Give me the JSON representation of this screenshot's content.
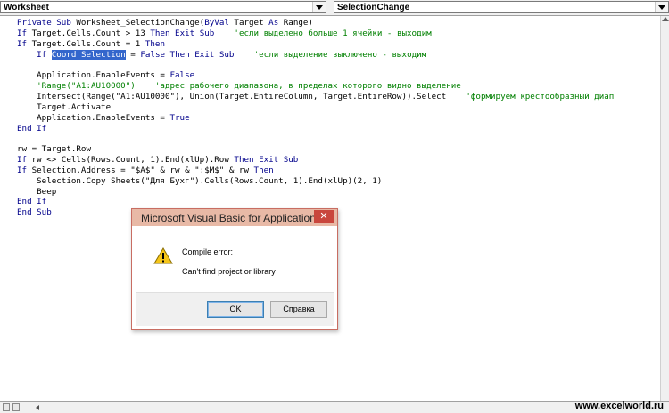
{
  "toolbar": {
    "object_combo": "Worksheet",
    "procedure_combo": "SelectionChange"
  },
  "code_lines": [
    [
      {
        "t": "Private Sub ",
        "c": "kw"
      },
      {
        "t": "Worksheet_SelectionChange(",
        "c": ""
      },
      {
        "t": "ByVal",
        "c": "kw"
      },
      {
        "t": " Target ",
        "c": ""
      },
      {
        "t": "As",
        "c": "kw"
      },
      {
        "t": " Range)",
        "c": ""
      }
    ],
    [
      {
        "t": "If",
        "c": "kw"
      },
      {
        "t": " Target.Cells.Count > 13 ",
        "c": ""
      },
      {
        "t": "Then Exit Sub",
        "c": "kw"
      },
      {
        "t": "    'если выделено больше 1 ячейки - выходим",
        "c": "cm"
      }
    ],
    [
      {
        "t": "If",
        "c": "kw"
      },
      {
        "t": " Target.Cells.Count = 1 ",
        "c": ""
      },
      {
        "t": "Then",
        "c": "kw"
      }
    ],
    [
      {
        "t": "    ",
        "c": ""
      },
      {
        "t": "If",
        "c": "kw"
      },
      {
        "t": " ",
        "c": ""
      },
      {
        "t": "Coord Selection",
        "c": "sel"
      },
      {
        "t": " = ",
        "c": ""
      },
      {
        "t": "False Then Exit Sub",
        "c": "kw"
      },
      {
        "t": "    'если выделение выключено - выходим",
        "c": "cm"
      }
    ],
    [],
    [
      {
        "t": "    Application.EnableEvents = ",
        "c": ""
      },
      {
        "t": "False",
        "c": "kw"
      }
    ],
    [
      {
        "t": "    'Range(\"A1:AU10000\")    'адрес рабочего диапазона, в пределах которого видно выделение",
        "c": "cm"
      }
    ],
    [
      {
        "t": "    Intersect(Range(\"A1:AU10000\"), Union(Target.EntireColumn, Target.EntireRow)).Select",
        "c": ""
      },
      {
        "t": "    'формируем крестообразный диап",
        "c": "cm"
      }
    ],
    [
      {
        "t": "    Target.Activate",
        "c": ""
      }
    ],
    [
      {
        "t": "    Application.EnableEvents = ",
        "c": ""
      },
      {
        "t": "True",
        "c": "kw"
      }
    ],
    [
      {
        "t": "End If",
        "c": "kw"
      }
    ],
    [],
    [
      {
        "t": "rw = Target.Row",
        "c": ""
      }
    ],
    [
      {
        "t": "If",
        "c": "kw"
      },
      {
        "t": " rw <> Cells(Rows.Count, 1).End(xlUp).Row ",
        "c": ""
      },
      {
        "t": "Then Exit Sub",
        "c": "kw"
      }
    ],
    [
      {
        "t": "If",
        "c": "kw"
      },
      {
        "t": " Selection.Address = \"$A$\" & rw & \":$M$\" & rw ",
        "c": ""
      },
      {
        "t": "Then",
        "c": "kw"
      }
    ],
    [
      {
        "t": "    Selection.Copy Sheets(\"Для Бухг\").Cells(Rows.Count, 1).End(xlUp)(2, 1)",
        "c": ""
      }
    ],
    [
      {
        "t": "    Beep",
        "c": ""
      }
    ],
    [
      {
        "t": "End If",
        "c": "kw"
      }
    ],
    [
      {
        "t": "End Sub",
        "c": "kw"
      }
    ]
  ],
  "dialog": {
    "title": "Microsoft Visual Basic for Applications",
    "close_glyph": "✕",
    "message_title": "Compile error:",
    "message": "Can't find project or library",
    "ok_label": "OK",
    "help_label": "Справка",
    "icon": "warning-icon"
  },
  "footer": {
    "watermark": "www.excelworld.ru"
  },
  "colors": {
    "keyword": "#00008b",
    "comment": "#008000",
    "selection": "#3366cc",
    "dialog_titlebar": "#e8b9a6",
    "close_button": "#c9463d"
  }
}
